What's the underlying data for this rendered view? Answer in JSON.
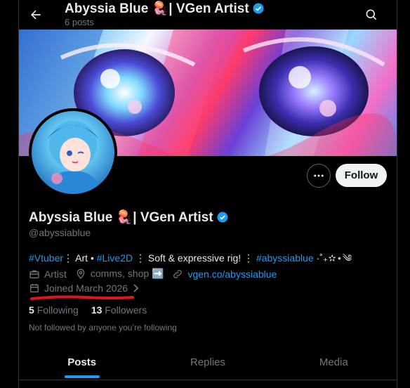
{
  "header": {
    "title": "Abyssia Blue 🪼| VGen Artist",
    "post_count": "6 posts"
  },
  "profile": {
    "name": "Abyssia Blue 🪼| VGen Artist",
    "handle": "@abyssiablue",
    "follow_label": "Follow",
    "bio": {
      "tag1": "#Vtuber",
      "sep1": "⋮ Art • ",
      "tag2": "#Live2D",
      "sep2": " ⋮ Soft & expressive rig! ⋮ ",
      "tag3": "#abyssiablue",
      "tail": " ·˚₊✫⋆༄"
    },
    "category": "Artist",
    "location": "comms, shop ➡️",
    "website": "vgen.co/abyssiablue",
    "joined": "Joined March 2026",
    "following_count": "5",
    "following_label": "Following",
    "followers_count": "13",
    "followers_label": "Followers",
    "not_followed": "Not followed by anyone you’re following"
  },
  "tabs": [
    {
      "label": "Posts"
    },
    {
      "label": "Replies"
    },
    {
      "label": "Media"
    }
  ],
  "colors": {
    "accent": "#1d9bf0",
    "annotation": "#e0141c"
  }
}
